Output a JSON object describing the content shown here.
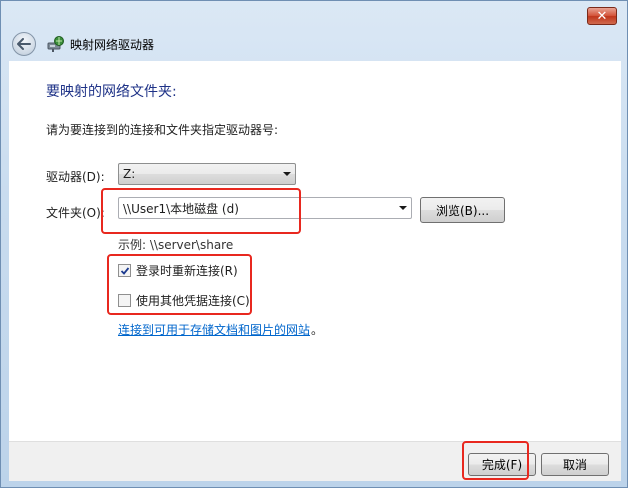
{
  "window": {
    "title": "映射网络驱动器",
    "close_glyph": "✕"
  },
  "content": {
    "heading": "要映射的网络文件夹:",
    "instruction": "请为要连接到的连接和文件夹指定驱动器号:",
    "drive": {
      "label": "驱动器(D):",
      "value": "Z:"
    },
    "folder": {
      "label": "文件夹(O):",
      "value": "\\\\User1\\本地磁盘 (d)"
    },
    "browse_button": "浏览(B)...",
    "example": "示例: \\\\server\\share",
    "reconnect": {
      "label": "登录时重新连接(R)",
      "checked": true
    },
    "other_credentials": {
      "label": "使用其他凭据连接(C)",
      "checked": false
    },
    "link": "连接到可用于存储文档和图片的网站",
    "link_suffix": "。"
  },
  "footer": {
    "finish_button": "完成(F)",
    "cancel_button": "取消"
  },
  "icons": {
    "back": "back-arrow-icon",
    "network_drive": "network-drive-icon",
    "close": "close-icon",
    "dropdown": "chevron-down-icon",
    "check": "checkmark-icon"
  },
  "colors": {
    "heading": "#1e3287",
    "link": "#0066cc",
    "highlight": "#e8281f",
    "close_button": "#c0361c"
  }
}
